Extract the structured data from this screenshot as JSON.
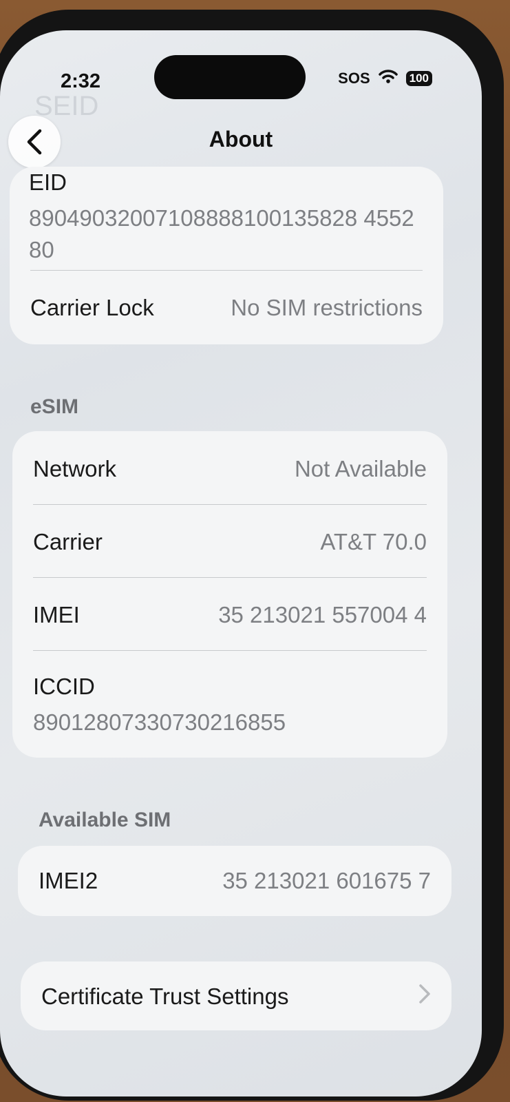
{
  "status_bar": {
    "time": "2:32",
    "sos": "SOS",
    "battery": "100"
  },
  "nav": {
    "title": "About",
    "ghost_title": "SEID"
  },
  "device_card": {
    "eid_label": "EID",
    "eid_value": "89049032007108888100135828 455280",
    "carrier_lock_label": "Carrier Lock",
    "carrier_lock_value": "No SIM restrictions"
  },
  "esim": {
    "section_label": "eSIM",
    "network_label": "Network",
    "network_value": "Not Available",
    "carrier_label": "Carrier",
    "carrier_value": "AT&T 70.0",
    "imei_label": "IMEI",
    "imei_value": "35 213021 557004 4",
    "iccid_label": "ICCID",
    "iccid_value": "89012807330730216855"
  },
  "available_sim": {
    "section_label": "Available SIM",
    "imei2_label": "IMEI2",
    "imei2_value": "35 213021 601675 7"
  },
  "certificate": {
    "label": "Certificate Trust Settings"
  }
}
